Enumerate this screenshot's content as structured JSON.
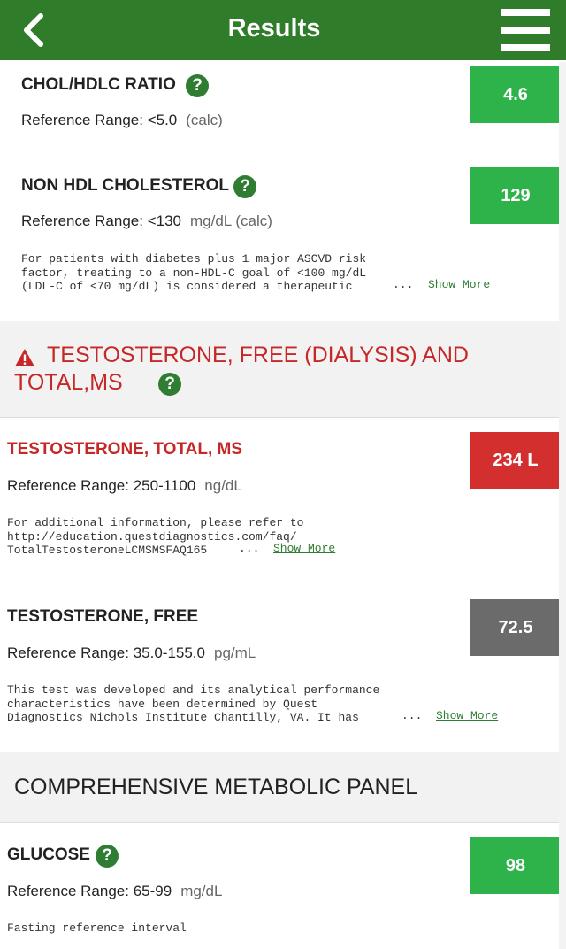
{
  "header": {
    "title": "Results",
    "bg_color": "#2f7d2b"
  },
  "icons": {
    "back": "chevron-left",
    "menu": "hamburger-menu",
    "help": "question-circle",
    "warning": "warning-triangle"
  },
  "help_glyph": "?",
  "colors": {
    "normal": "#2db34a",
    "abnormal": "#d32f2f",
    "neutral": "#6b6b6b",
    "flag_text": "#c62828"
  },
  "tests": [
    {
      "name": "CHOL/HDLC RATIO",
      "reference": "Reference Range: <5.0",
      "unit": "(calc)",
      "value": "4.6",
      "status": "normal"
    },
    {
      "name": "NON HDL CHOLESTEROL",
      "reference": "Reference Range: <130",
      "unit": "mg/dL (calc)",
      "value": "129",
      "status": "normal",
      "note": "For patients with diabetes plus 1 major ASCVD risk\nfactor, treating to a non-HDL-C goal of <100 mg/dL\n(LDL-C of <70 mg/dL) is considered a therapeutic",
      "ellipsis": "...",
      "show_more": "Show More"
    },
    {
      "name": "TESTOSTERONE, TOTAL, MS",
      "reference": "Reference Range: 250-1100",
      "unit": "ng/dL",
      "value": "234 L",
      "status": "abnormal",
      "note": "For additional information, please refer to\nhttp://education.questdiagnostics.com/faq/\nTotalTestosteroneLCMSMSFAQ165",
      "ellipsis": "...",
      "show_more": "Show More"
    },
    {
      "name": "TESTOSTERONE, FREE",
      "reference": "Reference Range: 35.0-155.0",
      "unit": "pg/mL",
      "value": "72.5",
      "status": "neutral",
      "note": "This test was developed and its analytical performance\ncharacteristics have been determined by Quest\nDiagnostics Nichols Institute Chantilly, VA. It has",
      "ellipsis": "...",
      "show_more": "Show More"
    },
    {
      "name": "GLUCOSE",
      "reference": "Reference Range: 65-99",
      "unit": "mg/dL",
      "value": "98",
      "status": "normal",
      "note": "Fasting reference interval"
    }
  ],
  "sections": [
    {
      "title_line1": "TESTOSTERONE, FREE (DIALYSIS) AND",
      "title_line2": "TOTAL,MS",
      "flagged": true
    },
    {
      "title_line1": "COMPREHENSIVE METABOLIC PANEL",
      "flagged": false
    }
  ]
}
